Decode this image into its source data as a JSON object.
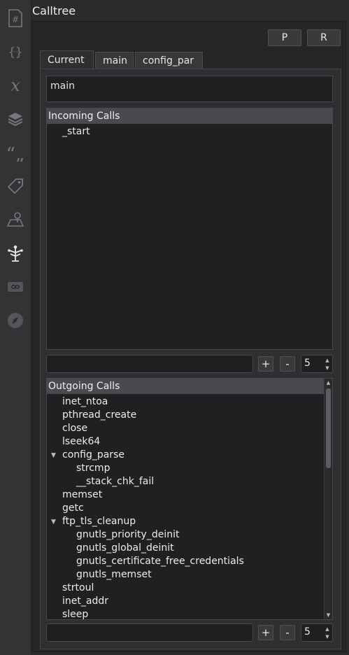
{
  "panel": {
    "title": "Calltree"
  },
  "sidebar": {
    "icons": [
      {
        "name": "hash-icon"
      },
      {
        "name": "braces-icon"
      },
      {
        "name": "variable-x-icon"
      },
      {
        "name": "layers-icon"
      },
      {
        "name": "quote-icon"
      },
      {
        "name": "tag-icon"
      },
      {
        "name": "map-pin-icon"
      },
      {
        "name": "calltree-icon",
        "active": true
      },
      {
        "name": "infinity-icon"
      },
      {
        "name": "compass-icon"
      }
    ]
  },
  "toolbar": {
    "p_label": "P",
    "r_label": "R"
  },
  "tabs": [
    {
      "label": "Current",
      "active": true
    },
    {
      "label": "main",
      "active": false
    },
    {
      "label": "config_par",
      "active": false
    }
  ],
  "current_function": "main",
  "incoming": {
    "header": "Incoming Calls",
    "items": [
      "_start"
    ],
    "filter_value": "",
    "plus_label": "+",
    "minus_label": "-",
    "depth": "5"
  },
  "outgoing": {
    "header": "Outgoing Calls",
    "rows": [
      {
        "label": "inet_ntoa",
        "level": 0,
        "expanded": null
      },
      {
        "label": "pthread_create",
        "level": 0,
        "expanded": null
      },
      {
        "label": "close",
        "level": 0,
        "expanded": null
      },
      {
        "label": "lseek64",
        "level": 0,
        "expanded": null
      },
      {
        "label": "config_parse",
        "level": 0,
        "expanded": true
      },
      {
        "label": "strcmp",
        "level": 1,
        "expanded": null
      },
      {
        "label": "__stack_chk_fail",
        "level": 1,
        "expanded": null
      },
      {
        "label": "memset",
        "level": 0,
        "expanded": null
      },
      {
        "label": "getc",
        "level": 0,
        "expanded": null
      },
      {
        "label": "ftp_tls_cleanup",
        "level": 0,
        "expanded": true
      },
      {
        "label": "gnutls_priority_deinit",
        "level": 1,
        "expanded": null
      },
      {
        "label": "gnutls_global_deinit",
        "level": 1,
        "expanded": null
      },
      {
        "label": "gnutls_certificate_free_credentials",
        "level": 1,
        "expanded": null
      },
      {
        "label": "gnutls_memset",
        "level": 1,
        "expanded": null
      },
      {
        "label": "strtoul",
        "level": 0,
        "expanded": null
      },
      {
        "label": "inet_addr",
        "level": 0,
        "expanded": null
      },
      {
        "label": "sleep",
        "level": 0,
        "expanded": null
      }
    ],
    "filter_value": "",
    "plus_label": "+",
    "minus_label": "-",
    "depth": "5"
  },
  "colors": {
    "background": "#2b2b2e",
    "header": "#4a4a4e",
    "text": "#e6e6e6"
  }
}
